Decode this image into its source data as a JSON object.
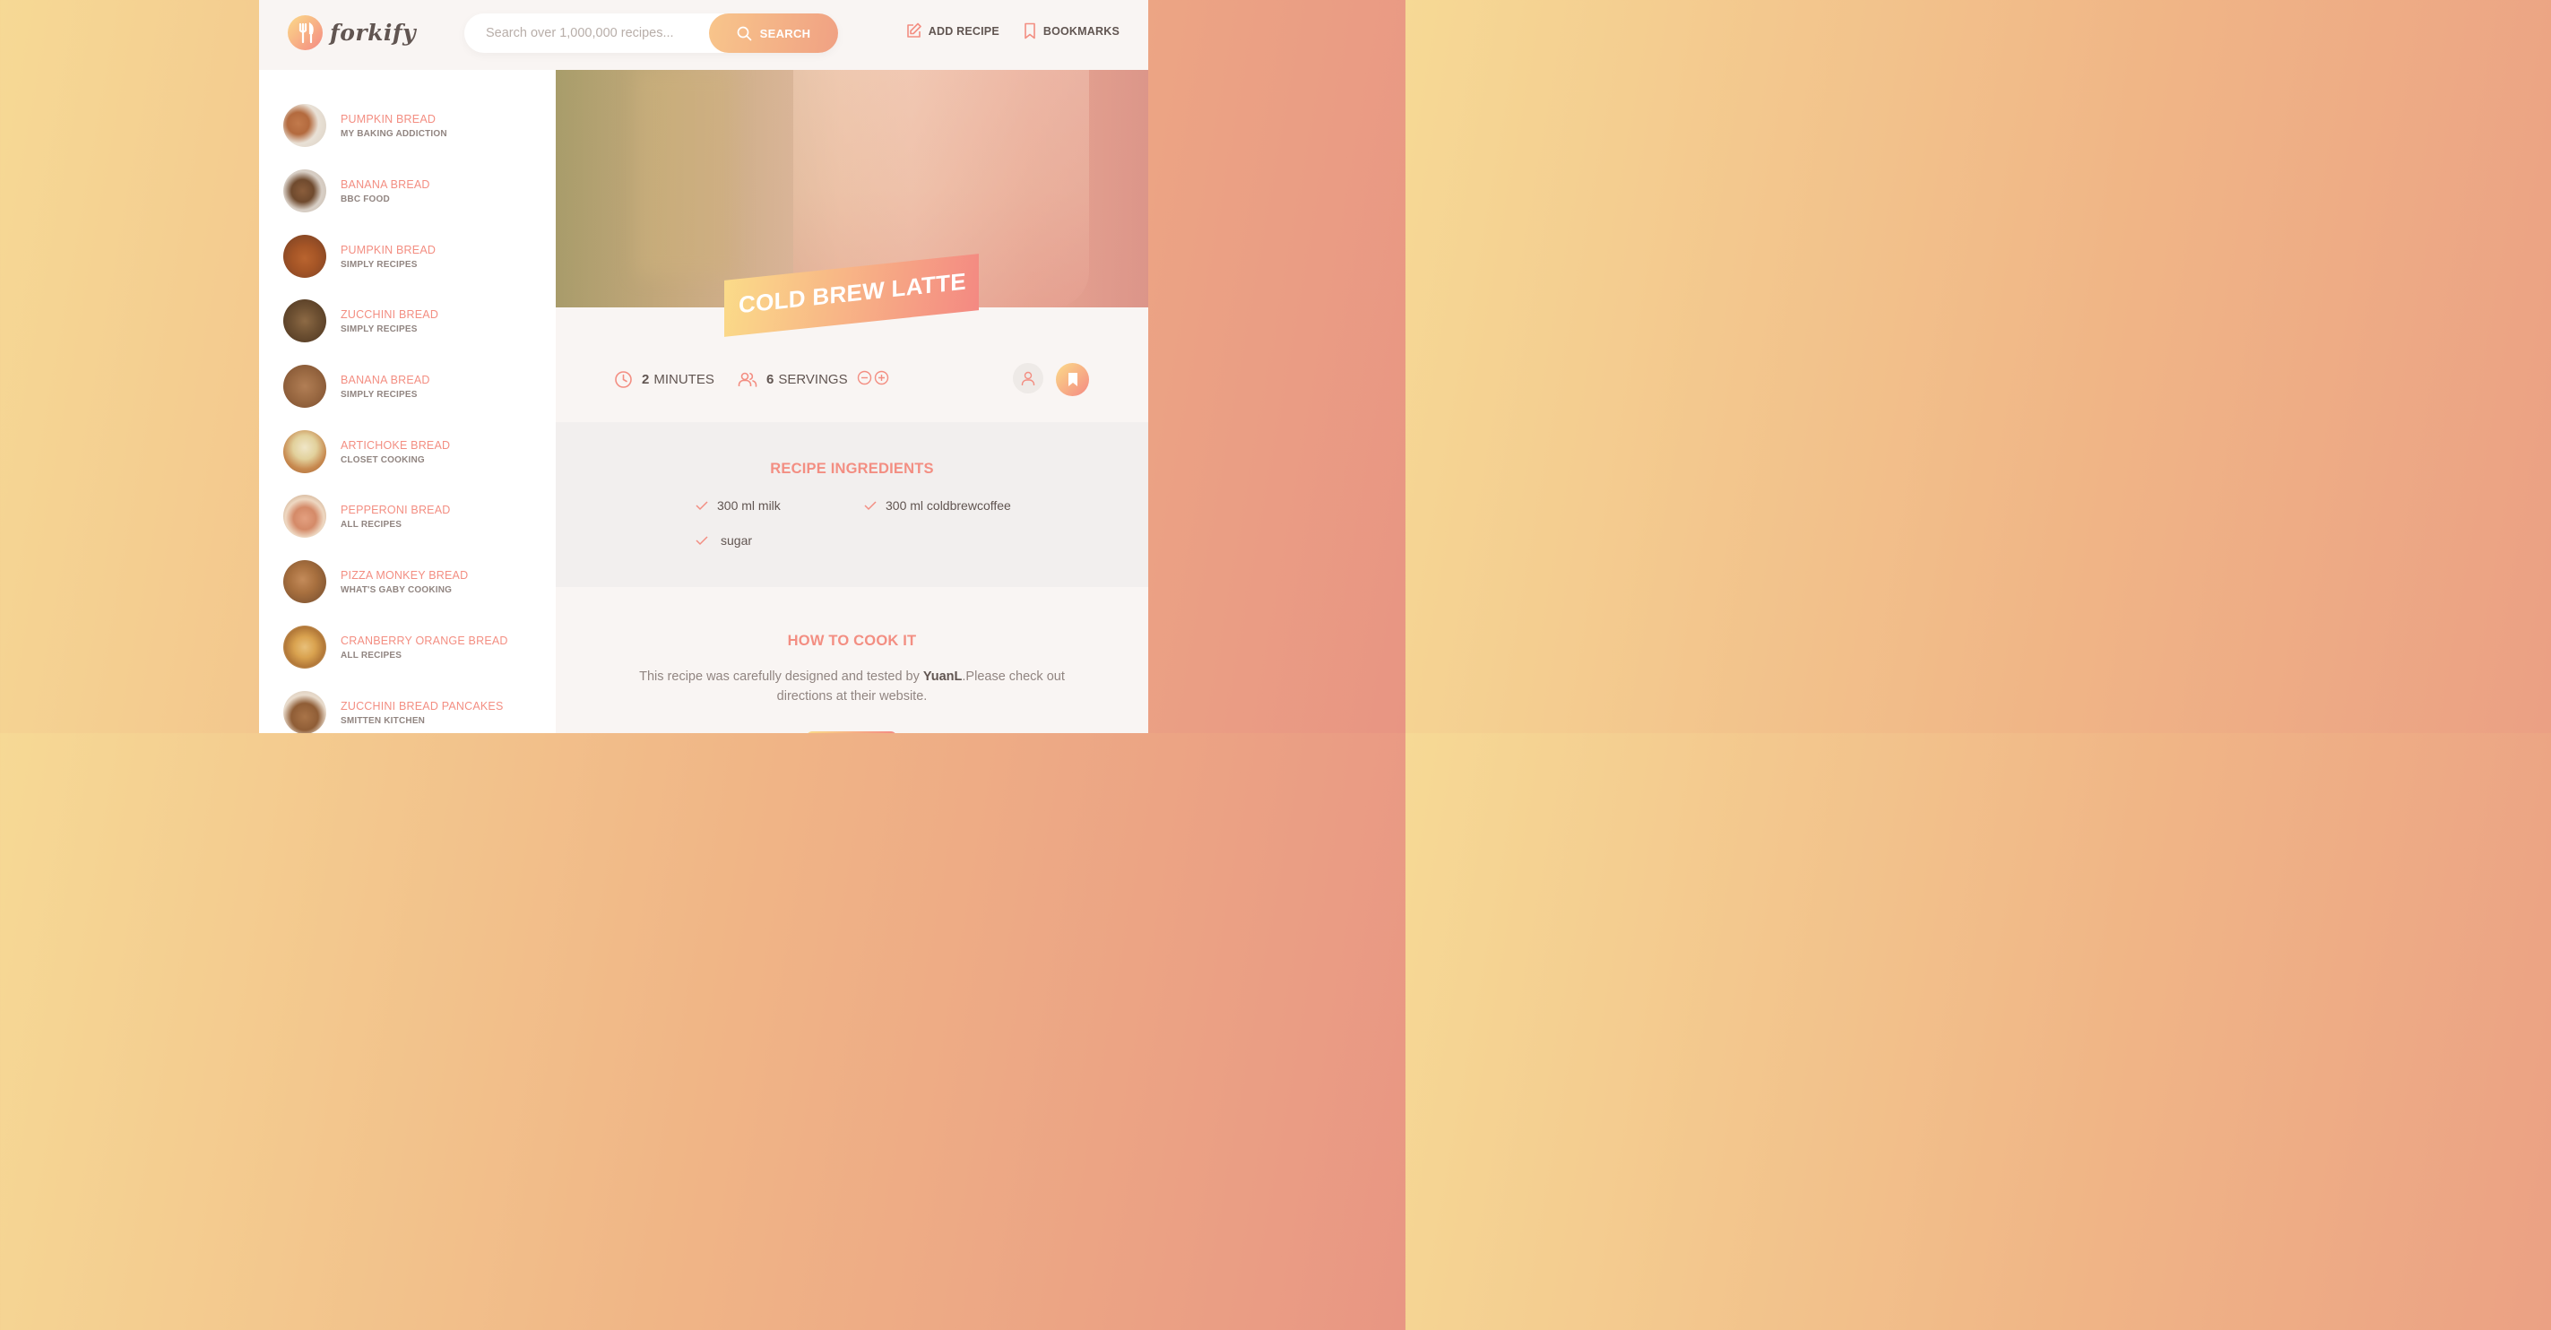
{
  "header": {
    "logo_text": "forkify",
    "search_placeholder": "Search over 1,000,000 recipes...",
    "search_button": "SEARCH",
    "add_recipe": "ADD RECIPE",
    "bookmarks": "BOOKMARKS"
  },
  "results": [
    {
      "title": "PUMPKIN BREAD",
      "publisher": "MY BAKING ADDICTION"
    },
    {
      "title": "BANANA BREAD",
      "publisher": "BBC FOOD"
    },
    {
      "title": "PUMPKIN BREAD",
      "publisher": "SIMPLY RECIPES"
    },
    {
      "title": "ZUCCHINI BREAD",
      "publisher": "SIMPLY RECIPES"
    },
    {
      "title": "BANANA BREAD",
      "publisher": "SIMPLY RECIPES"
    },
    {
      "title": "ARTICHOKE BREAD",
      "publisher": "CLOSET COOKING"
    },
    {
      "title": "PEPPERONI BREAD",
      "publisher": "ALL RECIPES"
    },
    {
      "title": "PIZZA MONKEY BREAD",
      "publisher": "WHAT'S GABY COOKING"
    },
    {
      "title": "CRANBERRY ORANGE BREAD",
      "publisher": "ALL RECIPES"
    },
    {
      "title": "ZUCCHINI BREAD PANCAKES",
      "publisher": "SMITTEN KITCHEN"
    }
  ],
  "recipe": {
    "title": "COLD BREW LATTE",
    "minutes": "2",
    "minutes_label": "MINUTES",
    "servings": "6",
    "servings_label": "SERVINGS",
    "ingredients_title": "RECIPE INGREDIENTS",
    "ingredients": [
      "300 ml milk",
      "300 ml coldbrewcoffee",
      "sugar"
    ],
    "directions_title": "HOW TO COOK IT",
    "directions_pre": "This recipe was carefully designed and tested by ",
    "publisher": "YuanL",
    "directions_post": ".Please check out directions at their website."
  },
  "colors": {
    "accent": "#f38e82",
    "gradient_start": "#fbdb89",
    "gradient_end": "#f48982"
  }
}
